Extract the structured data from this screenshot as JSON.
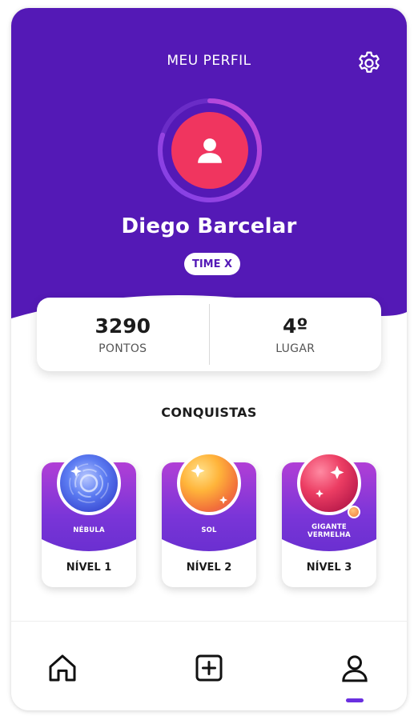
{
  "header": {
    "title": "MEU PERFIL",
    "settings_icon": "gear-icon",
    "background_color": "#5419b6"
  },
  "profile": {
    "name": "Diego Barcelar",
    "team": "TIME X",
    "avatar_icon": "user-icon",
    "avatar_color": "#f0355f",
    "progress_ring_fraction": 0.8
  },
  "stats": {
    "points": {
      "value": "3290",
      "label": "PONTOS"
    },
    "rank": {
      "value": "4º",
      "label": "LUGAR"
    }
  },
  "achievements": {
    "title": "CONQUISTAS",
    "items": [
      {
        "name": "NÉBULA",
        "level": "NÍVEL 1",
        "icon": "nebula-orb-icon"
      },
      {
        "name": "SOL",
        "level": "NÍVEL 2",
        "icon": "sun-orb-icon"
      },
      {
        "name": "GIGANTE VERMELHA",
        "level": "NÍVEL 3",
        "icon": "red-giant-orb-icon"
      }
    ]
  },
  "nav": {
    "items": [
      {
        "name": "home",
        "icon": "home-icon"
      },
      {
        "name": "add",
        "icon": "plus-square-icon"
      },
      {
        "name": "profile",
        "icon": "user-icon",
        "active": true
      }
    ],
    "accent": "#6a2fe0"
  }
}
